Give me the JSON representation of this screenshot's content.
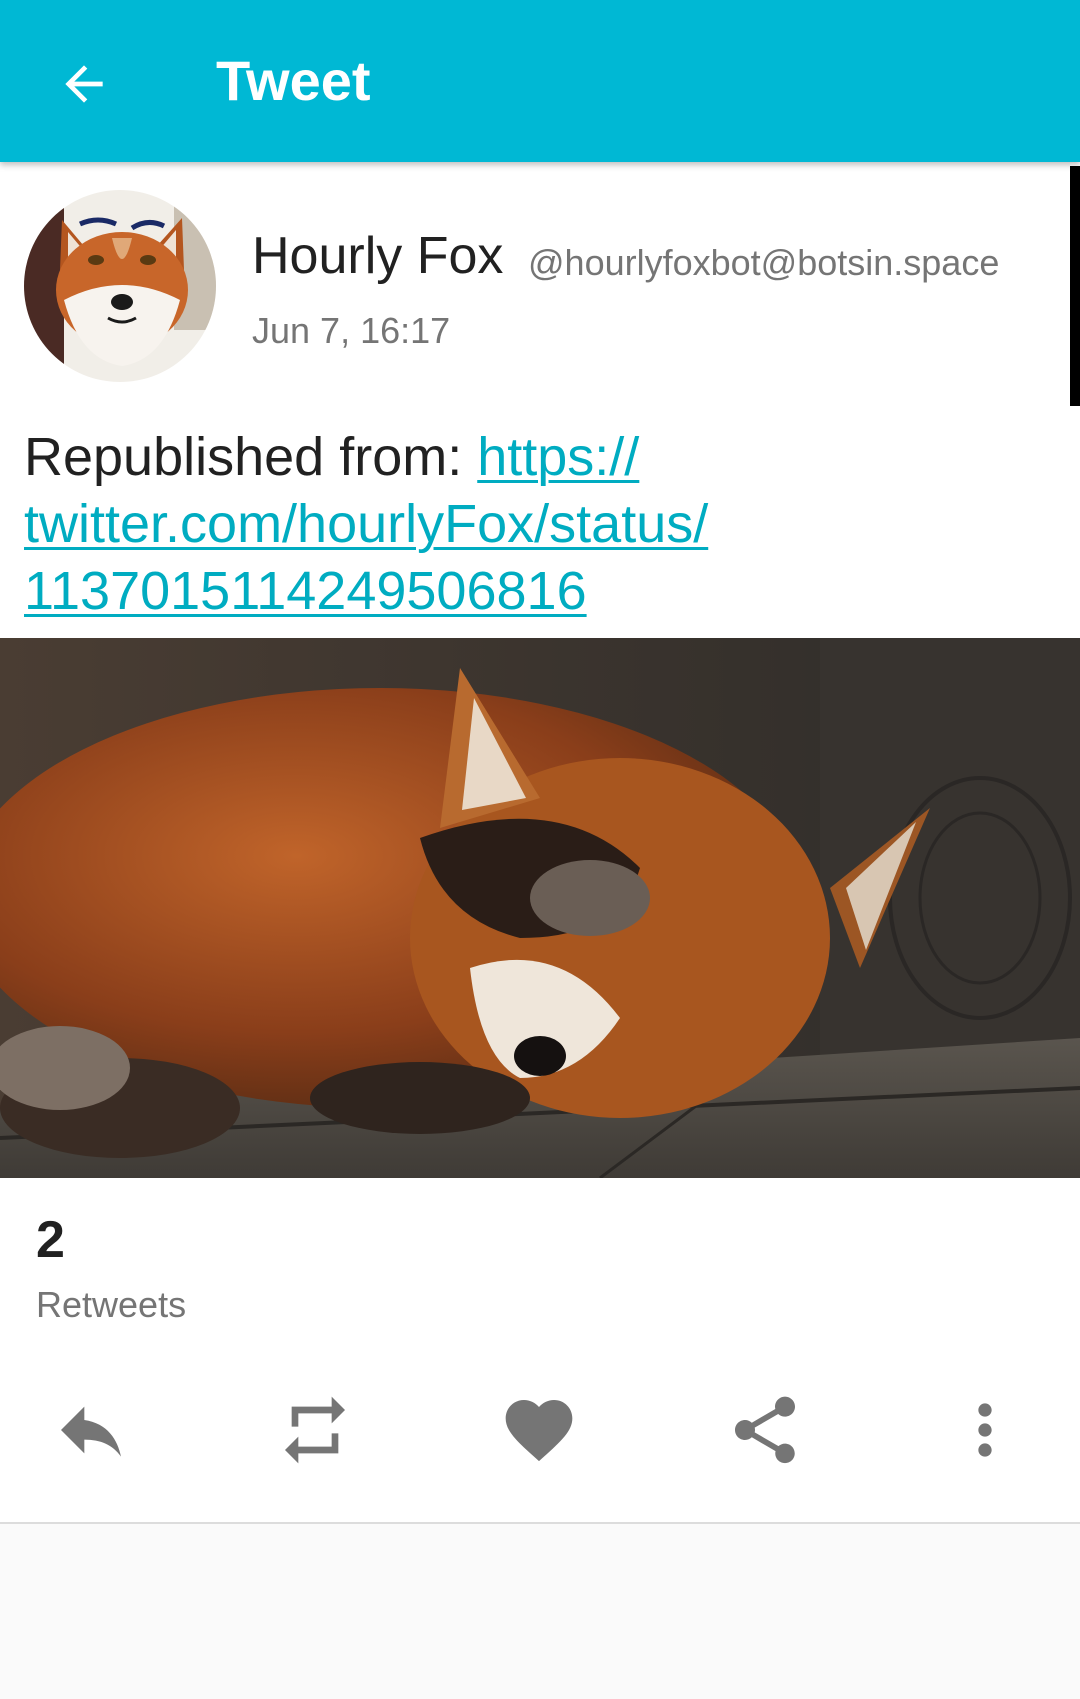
{
  "appbar": {
    "title": "Tweet",
    "color": "#00b8d4",
    "back_icon": "arrow-back-icon"
  },
  "status": {
    "display_name": "Hourly Fox",
    "username": "@hourlyfoxbot@botsin.space",
    "timestamp": "Jun 7, 16:17",
    "content_prefix": "Republished from: ",
    "link_line1": "https://",
    "link_line2": "twitter.com/hourlyFox/status/",
    "link_line3": "1137015114249506816",
    "link_color": "#00acc1"
  },
  "stats": {
    "retweets_count": "2",
    "retweets_label": "Retweets"
  },
  "actions": {
    "reply_icon": "reply-icon",
    "retweet_icon": "retweet-icon",
    "favourite_icon": "heart-icon",
    "share_icon": "share-icon",
    "more_icon": "more-vertical-icon"
  }
}
